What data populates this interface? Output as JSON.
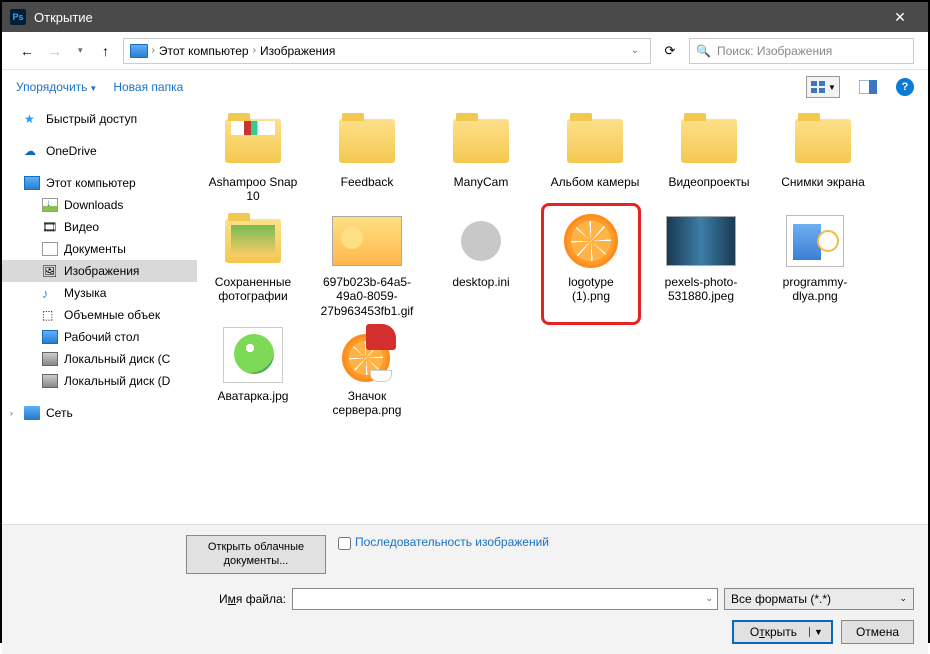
{
  "titlebar": {
    "title": "Открытие"
  },
  "path": {
    "root": "Этот компьютер",
    "folder": "Изображения"
  },
  "search": {
    "placeholder": "Поиск: Изображения"
  },
  "toolbar": {
    "organize": "Упорядочить",
    "newfolder": "Новая папка"
  },
  "sidebar": {
    "quick": "Быстрый доступ",
    "onedrive": "OneDrive",
    "thispc": "Этот компьютер",
    "downloads": "Downloads",
    "videos": "Видео",
    "documents": "Документы",
    "images": "Изображения",
    "music": "Музыка",
    "volumes": "Объемные объек",
    "desktop": "Рабочий стол",
    "localc": "Локальный диск (C",
    "locald": "Локальный диск (D",
    "network": "Сеть"
  },
  "files": {
    "f1": "Ashampoo Snap 10",
    "f2": "Feedback",
    "f3": "ManyCam",
    "f4": "Альбом камеры",
    "f5": "Видеопроекты",
    "f6": "Снимки экрана",
    "f7": "Сохраненные фотографии",
    "f8": "697b023b-64a5-49a0-8059-27b963453fb1.gif",
    "f9": "desktop.ini",
    "f10": "logotype (1).png",
    "f11": "pexels-photo-531880.jpeg",
    "f12": "programmy-dlya.png",
    "f13": "Аватарка.jpg",
    "f14": "Значок сервера.png"
  },
  "bottom": {
    "cloud": "Открыть облачные документы...",
    "sequence": "Последовательность изображений",
    "filelabel_pre": "И",
    "filelabel_u": "м",
    "filelabel_post": "я файла:",
    "format": "Все форматы (*.*)",
    "open_pre": "О",
    "open_u": "т",
    "open_post": "крыть",
    "cancel": "Отмена"
  }
}
